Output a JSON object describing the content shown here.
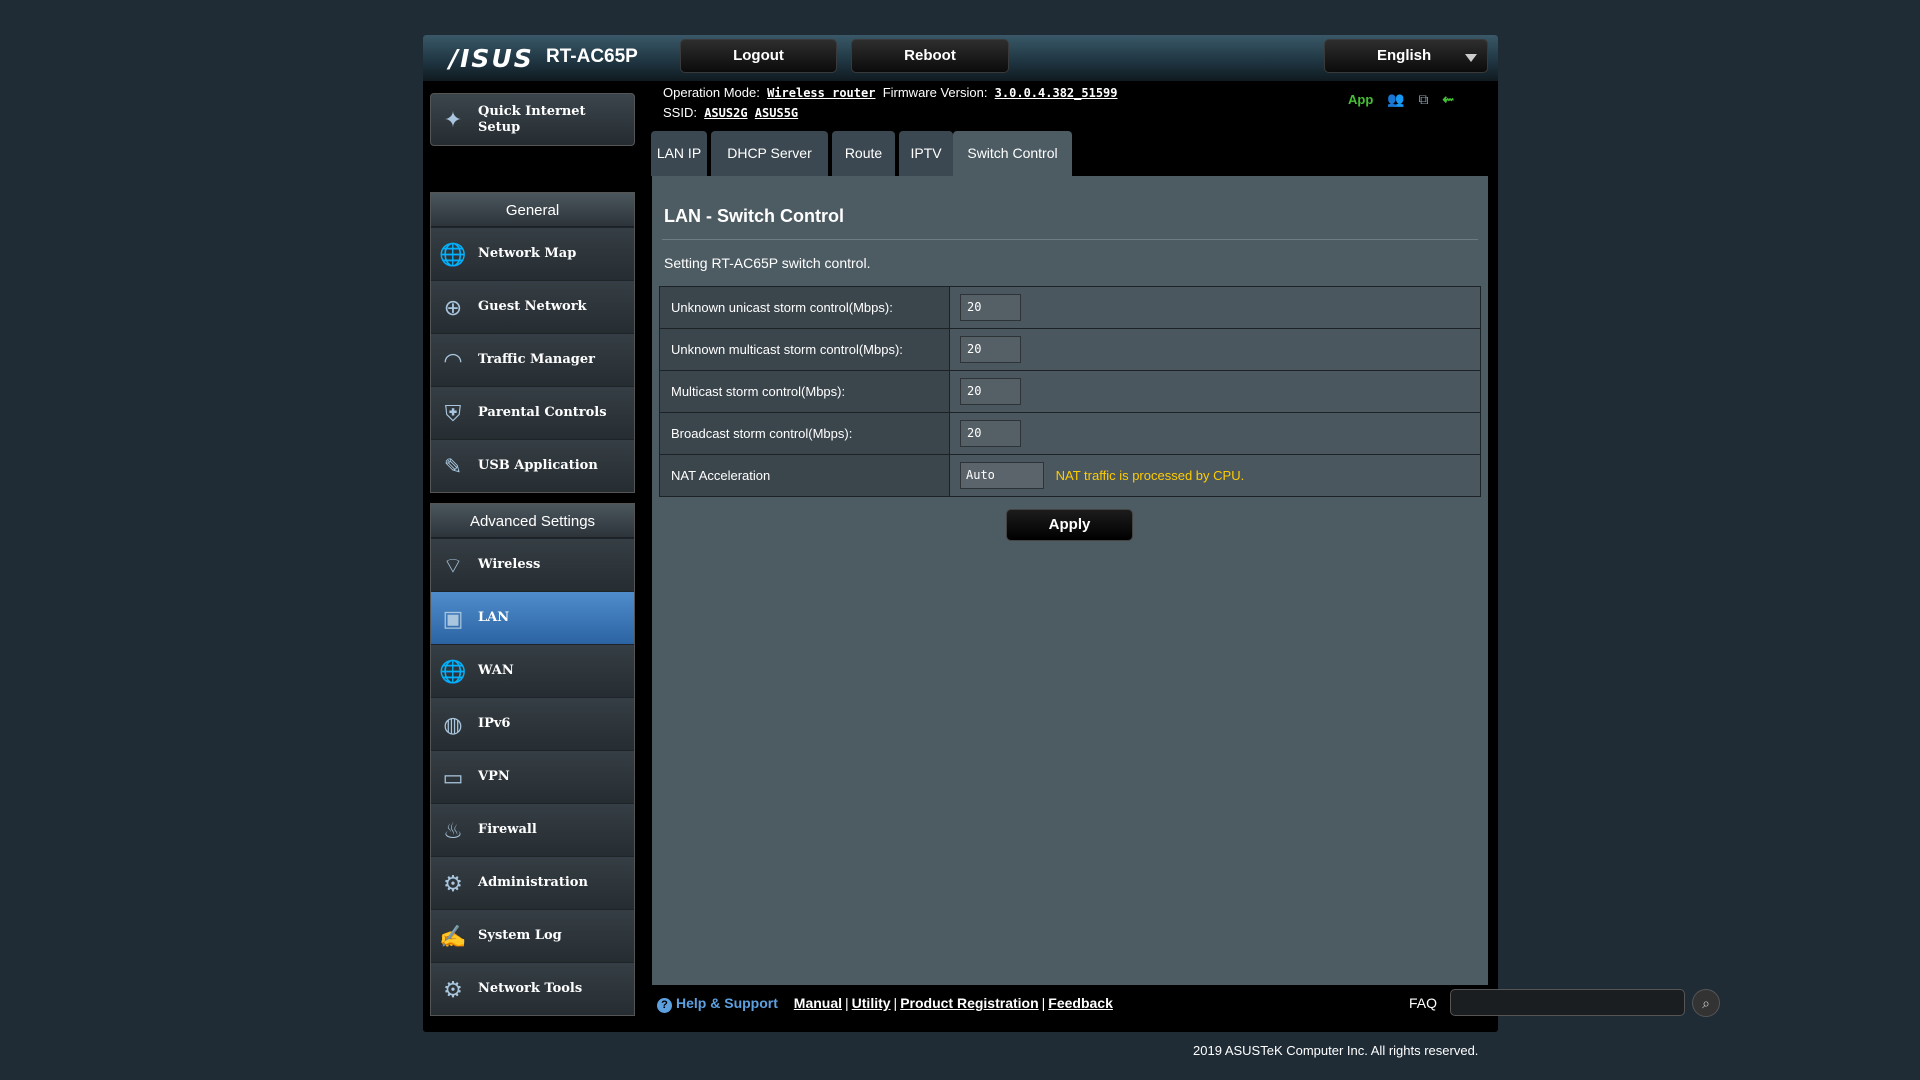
{
  "header": {
    "brand": "/ISUS",
    "model": "RT-AC65P",
    "logout_label": "Logout",
    "reboot_label": "Reboot",
    "language": "English"
  },
  "status": {
    "op_mode_label": "Operation Mode:",
    "op_mode_value": "Wireless router",
    "fw_label": "Firmware Version:",
    "fw_value": "3.0.0.4.382_51599",
    "ssid_label": "SSID:",
    "ssid_2g": "ASUS2G",
    "ssid_5g": "ASUS5G",
    "app_label": "App",
    "icons": [
      "clients-icon",
      "network-icon",
      "usb-icon"
    ]
  },
  "sidebar": {
    "quick_setup": {
      "label_line1": "Quick Internet",
      "label_line2": "Setup",
      "icon": "wand-icon"
    },
    "general_header": "General",
    "general_items": [
      {
        "label": "Network Map",
        "icon": "globe-icon"
      },
      {
        "label": "Guest Network",
        "icon": "guest-globe-icon"
      },
      {
        "label": "Traffic Manager",
        "icon": "gauge-icon"
      },
      {
        "label": "Parental Controls",
        "icon": "lock-shield-icon"
      },
      {
        "label": "USB Application",
        "icon": "puzzle-icon"
      }
    ],
    "advanced_header": "Advanced Settings",
    "advanced_items": [
      {
        "label": "Wireless",
        "icon": "wifi-icon"
      },
      {
        "label": "LAN",
        "icon": "lan-icon",
        "active": true
      },
      {
        "label": "WAN",
        "icon": "wan-globe-icon"
      },
      {
        "label": "IPv6",
        "icon": "ipv6-icon"
      },
      {
        "label": "VPN",
        "icon": "vpn-icon"
      },
      {
        "label": "Firewall",
        "icon": "fire-icon"
      },
      {
        "label": "Administration",
        "icon": "admin-gear-icon"
      },
      {
        "label": "System Log",
        "icon": "log-icon"
      },
      {
        "label": "Network Tools",
        "icon": "tools-gear-icon"
      }
    ]
  },
  "tabs": [
    "LAN IP",
    "DHCP Server",
    "Route",
    "IPTV",
    "Switch Control"
  ],
  "active_tab": "Switch Control",
  "panel": {
    "title": "LAN - Switch Control",
    "description": "Setting RT-AC65P switch control.",
    "rows": [
      {
        "label": "Unknown unicast storm control(Mbps):",
        "value": "20"
      },
      {
        "label": "Unknown multicast storm control(Mbps):",
        "value": "20"
      },
      {
        "label": "Multicast storm control(Mbps):",
        "value": "20"
      },
      {
        "label": "Broadcast storm control(Mbps):",
        "value": "20"
      }
    ],
    "nat_label": "NAT Acceleration",
    "nat_value": "Auto",
    "nat_note": "NAT traffic is processed by CPU.",
    "apply_label": "Apply"
  },
  "footer": {
    "help_label": "Help & Support",
    "links": [
      "Manual",
      "Utility",
      "Product Registration",
      "Feedback"
    ],
    "faq_label": "FAQ",
    "copyright": "2019 ASUSTeK Computer Inc. All rights reserved."
  },
  "colors": {
    "background": "#1f2c36",
    "panel": "#4d5b63",
    "active_menu": "#3a7bc0",
    "note": "#ffcc00",
    "app_green": "#44c035",
    "help_blue": "#5da0e0"
  }
}
